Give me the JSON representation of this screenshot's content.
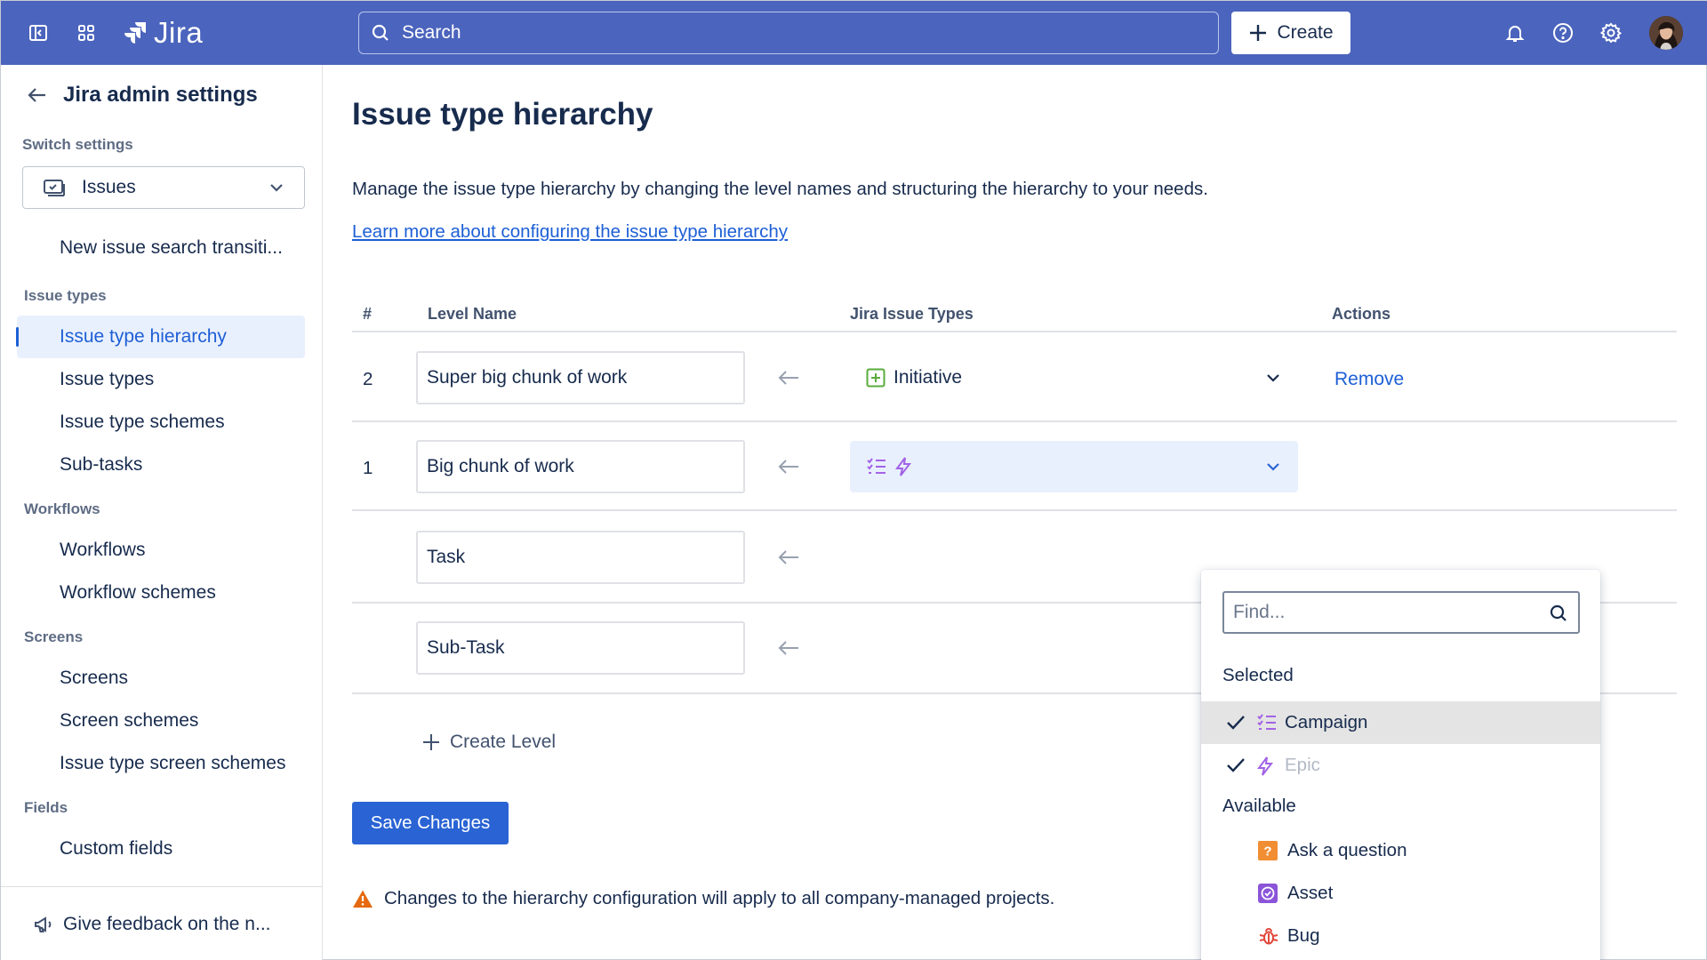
{
  "app": {
    "brand": "Jira",
    "accent": "#4b64bd",
    "link_color": "#1d5fd6"
  },
  "topbar": {
    "search_placeholder": "Search",
    "create_label": "Create",
    "icons": [
      "sidebar-toggle-icon",
      "app-switcher-icon",
      "jira-logo-icon",
      "bell-icon",
      "help-icon",
      "gear-icon"
    ]
  },
  "sidebar": {
    "title": "Jira admin settings",
    "switch_caption": "Switch settings",
    "switch_value": "Issues",
    "top_item": "New issue search transiti...",
    "sections": [
      {
        "label": "Issue types",
        "items": [
          "Issue type hierarchy",
          "Issue types",
          "Issue type schemes",
          "Sub-tasks"
        ]
      },
      {
        "label": "Workflows",
        "items": [
          "Workflows",
          "Workflow schemes"
        ]
      },
      {
        "label": "Screens",
        "items": [
          "Screens",
          "Screen schemes",
          "Issue type screen schemes"
        ]
      },
      {
        "label": "Fields",
        "items": [
          "Custom fields"
        ]
      }
    ],
    "active_item": "Issue type hierarchy",
    "footer": "Give feedback on the n..."
  },
  "main": {
    "title": "Issue type hierarchy",
    "description": "Manage the issue type hierarchy by changing the level names and structuring the hierarchy to your needs.",
    "learn_link": "Learn more about configuring the issue type hierarchy",
    "columns": [
      "#",
      "Level Name",
      "Jira Issue Types",
      "Actions"
    ],
    "rows": [
      {
        "num": "2",
        "level_name": "Super big chunk of work",
        "issue_type": "Initiative",
        "action": "Remove"
      },
      {
        "num": "1",
        "level_name": "Big chunk of work",
        "issue_type": "",
        "action": ""
      },
      {
        "num": "",
        "level_name": "Task",
        "issue_type": "",
        "action": ""
      },
      {
        "num": "",
        "level_name": "Sub-Task",
        "issue_type": "",
        "action": ""
      }
    ],
    "create_level": "Create Level",
    "save_label": "Save Changes",
    "warning": "Changes to the hierarchy configuration will apply to all company-managed projects."
  },
  "dropdown": {
    "find_placeholder": "Find...",
    "selected_label": "Selected",
    "selected": [
      "Campaign",
      "Epic"
    ],
    "available_label": "Available",
    "available": [
      "Ask a question",
      "Asset",
      "Bug"
    ]
  }
}
